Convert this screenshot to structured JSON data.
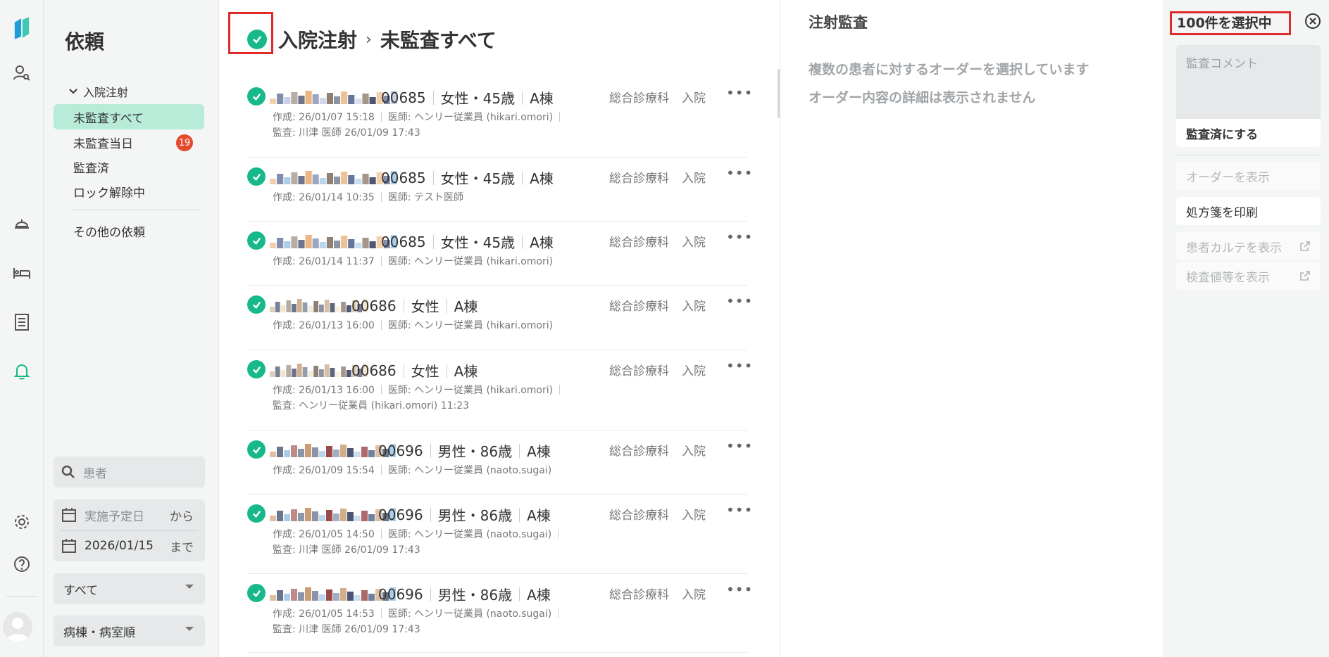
{
  "sidebar": {
    "title": "依頼",
    "group_label": "入院注射",
    "items": [
      {
        "label": "未監査すべて",
        "active": true
      },
      {
        "label": "未監査当日",
        "badge": "19"
      },
      {
        "label": "監査済"
      },
      {
        "label": "ロック解除中"
      }
    ],
    "other_label": "その他の依頼",
    "search_placeholder": "患者",
    "date_from_placeholder": "実施予定日",
    "date_from_suffix": "から",
    "date_to_value": "2026/01/15",
    "date_to_suffix": "まで",
    "filter_select": "すべて",
    "sort_select": "病棟・病室順"
  },
  "main": {
    "breadcrumb_parent": "入院注射",
    "breadcrumb_current": "未監査すべて",
    "rows": [
      {
        "pid": "00685",
        "gender_age": "女性・45歳",
        "ward": "A棟",
        "dept": "総合診療科",
        "type": "入院",
        "created": "作成: 26/01/07 15:18",
        "doctor": "医師: ヘンリー従業員 (hikari.omori)",
        "audit": "監査: 川津 医師 26/01/09 17:43"
      },
      {
        "pid": "00685",
        "gender_age": "女性・45歳",
        "ward": "A棟",
        "dept": "総合診療科",
        "type": "入院",
        "created": "作成: 26/01/14 10:35",
        "doctor": "医師: テスト医師",
        "audit": ""
      },
      {
        "pid": "00685",
        "gender_age": "女性・45歳",
        "ward": "A棟",
        "dept": "総合診療科",
        "type": "入院",
        "created": "作成: 26/01/14 11:37",
        "doctor": "医師: ヘンリー従業員 (hikari.omori)",
        "audit": ""
      },
      {
        "pid": "00686",
        "gender_age": "女性",
        "ward": "A棟",
        "dept": "総合診療科",
        "type": "入院",
        "created": "作成: 26/01/13 16:00",
        "doctor": "医師: ヘンリー従業員 (hikari.omori)",
        "audit": ""
      },
      {
        "pid": "00686",
        "gender_age": "女性",
        "ward": "A棟",
        "dept": "総合診療科",
        "type": "入院",
        "created": "作成: 26/01/13 16:00",
        "doctor": "医師: ヘンリー従業員 (hikari.omori)",
        "audit": "監査: ヘンリー従業員 (hikari.omori) 11:23"
      },
      {
        "pid": "00696",
        "gender_age": "男性・86歳",
        "ward": "A棟",
        "dept": "総合診療科",
        "type": "入院",
        "created": "作成: 26/01/09 15:54",
        "doctor": "医師: ヘンリー従業員 (naoto.sugai)",
        "audit": ""
      },
      {
        "pid": "00696",
        "gender_age": "男性・86歳",
        "ward": "A棟",
        "dept": "総合診療科",
        "type": "入院",
        "created": "作成: 26/01/05 14:50",
        "doctor": "医師: ヘンリー従業員 (naoto.sugai)",
        "audit": "監査: 川津 医師 26/01/09 17:43"
      },
      {
        "pid": "00696",
        "gender_age": "男性・86歳",
        "ward": "A棟",
        "dept": "総合診療科",
        "type": "入院",
        "created": "作成: 26/01/05 14:53",
        "doctor": "医師: ヘンリー従業員 (naoto.sugai)",
        "audit": "監査: 川津 医師 26/01/09 17:43"
      }
    ]
  },
  "detail": {
    "title": "注射監査",
    "message_1": "複数の患者に対するオーダーを選択しています",
    "message_2": "オーダー内容の詳細は表示されません"
  },
  "actions": {
    "selected_count": "100件を選択中",
    "comment_placeholder": "監査コメント",
    "mark_audited": "監査済にする",
    "show_order": "オーダーを表示",
    "print_prescription": "処方箋を印刷",
    "show_chart": "患者カルテを表示",
    "show_tests": "検査値等を表示"
  },
  "colors": {
    "accent_green": "#18b989",
    "active_bg": "#b8ecd9",
    "badge_red": "#e44a2e",
    "highlight_red": "#e12a2a"
  }
}
